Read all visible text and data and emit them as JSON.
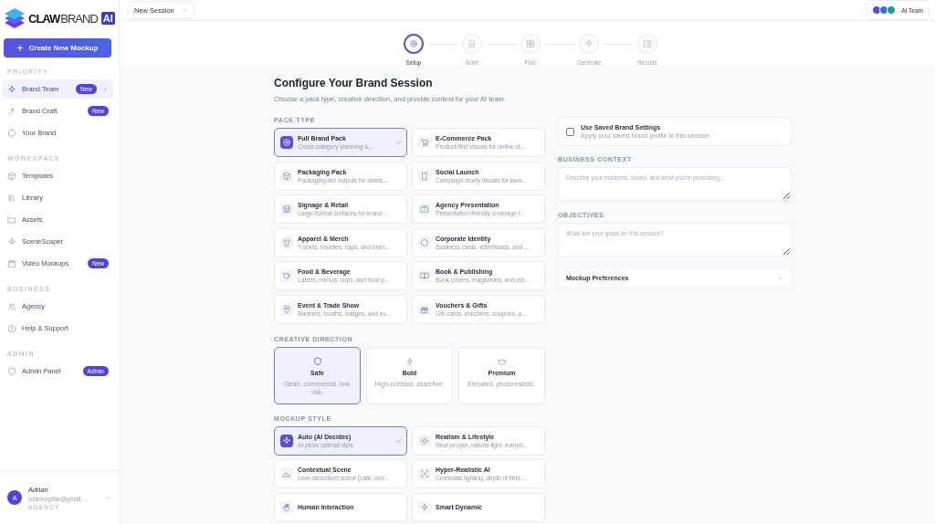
{
  "logo": {
    "parts": [
      "CLAW",
      "BRAND",
      "AI"
    ]
  },
  "sidebar": {
    "create_button": {
      "icon": "+",
      "label": "Create New Mockup"
    },
    "sections": [
      {
        "title": "PRIORITY",
        "items": [
          {
            "label": "Brand Team",
            "badge": "New",
            "selected": true,
            "chevron": true
          },
          {
            "label": "Brand Craft",
            "badge": "New",
            "selected": false
          },
          {
            "label": "Your Brand",
            "selected": false
          }
        ]
      },
      {
        "title": "WORKSPACE",
        "items": [
          {
            "label": "Templates",
            "selected": false
          },
          {
            "label": "Library",
            "selected": false
          },
          {
            "label": "Assets",
            "selected": false
          },
          {
            "label": "SceneScaper",
            "selected": false
          },
          {
            "label": "Video Mockups",
            "badge": "New",
            "selected": false
          }
        ]
      },
      {
        "title": "BUSINESS",
        "items": [
          {
            "label": "Agency",
            "selected": false
          },
          {
            "label": "Help & Support",
            "selected": false
          }
        ]
      },
      {
        "title": "ADMIN",
        "items": [
          {
            "label": "Admin Panel",
            "badge": "Admin",
            "selected": false
          }
        ]
      }
    ],
    "user": {
      "initial": "A",
      "name": "Adrian",
      "email": "isfanbogdan@gmail....",
      "role": "AGENCY"
    }
  },
  "topbar": {
    "session_select": "New Session",
    "team": {
      "label": "AI Team",
      "avatars": [
        {
          "color": "#5b4bd6"
        },
        {
          "color": "#3b6fe0"
        },
        {
          "color": "#17a08a"
        }
      ]
    }
  },
  "stepper": [
    {
      "label": "Setup",
      "selected": true
    },
    {
      "label": "Brief",
      "selected": false
    },
    {
      "label": "Plan",
      "selected": false
    },
    {
      "label": "Generate",
      "selected": false
    },
    {
      "label": "Results",
      "selected": false
    }
  ],
  "heading": "Configure Your Brand Session",
  "subheading": "Choose a pack type, creative direction, and provide context for your AI team.",
  "pack_type": {
    "title": "PACK TYPE",
    "options": [
      {
        "title": "Full Brand Pack",
        "desc": "Cross-category planning a...",
        "selected": true
      },
      {
        "title": "E-Commerce Pack",
        "desc": "Product-first visuals for online st...",
        "selected": false
      },
      {
        "title": "Packaging Pack",
        "desc": "Packaging-led outputs for labels,...",
        "selected": false
      },
      {
        "title": "Social Launch",
        "desc": "Campaign-ready visuals for laun...",
        "selected": false
      },
      {
        "title": "Signage & Retail",
        "desc": "Large-format surfaces for brand ...",
        "selected": false
      },
      {
        "title": "Agency Presentation",
        "desc": "Presentation-friendly coverage f...",
        "selected": false
      },
      {
        "title": "Apparel & Merch",
        "desc": "T-shirts, hoodies, caps, and bran...",
        "selected": false
      },
      {
        "title": "Corporate Identity",
        "desc": "Business cards, letterheads, and ...",
        "selected": false
      },
      {
        "title": "Food & Beverage",
        "desc": "Labels, menus, cups, and food p...",
        "selected": false
      },
      {
        "title": "Book & Publishing",
        "desc": "Book covers, magazines, and edi...",
        "selected": false
      },
      {
        "title": "Event & Trade Show",
        "desc": "Banners, booths, badges, and ev...",
        "selected": false
      },
      {
        "title": "Vouchers & Gifts",
        "desc": "Gift cards, vouchers, coupons, a...",
        "selected": false
      }
    ]
  },
  "creative_direction": {
    "title": "CREATIVE DIRECTION",
    "options": [
      {
        "title": "Safe",
        "desc": "Clean, commercial, low-risk.",
        "selected": true
      },
      {
        "title": "Bold",
        "desc": "High-contrast, assertive.",
        "selected": false
      },
      {
        "title": "Premium",
        "desc": "Elevated, photorealistic.",
        "selected": false
      }
    ]
  },
  "mockup_style": {
    "title": "MOCKUP STYLE",
    "options": [
      {
        "title": "Auto (AI Decides)",
        "desc": "AI picks optimal style",
        "selected": true
      },
      {
        "title": "Realism & Lifestyle",
        "desc": "Real people, natural light, everyd...",
        "selected": false
      },
      {
        "title": "Contextual Scene",
        "desc": "User-described scene (cafe, wor...",
        "selected": false
      },
      {
        "title": "Hyper-Realistic AI",
        "desc": "Cinematic lighting, depth of field,...",
        "selected": false
      },
      {
        "title": "Human Interaction",
        "selected": false
      },
      {
        "title": "Smart Dynamic",
        "selected": false
      }
    ]
  },
  "saved_settings": {
    "label": "Use Saved Brand Settings",
    "desc": "Apply your saved brand profile to this session",
    "checked": false
  },
  "business_context": {
    "title": "BUSINESS CONTEXT",
    "placeholder": "Describe your business, brand, and what you're promoting..."
  },
  "objectives": {
    "title": "OBJECTIVES",
    "placeholder": "What are your goals for this session?"
  },
  "preferences": {
    "label": "Mockup Preferences",
    "expanded": false
  }
}
